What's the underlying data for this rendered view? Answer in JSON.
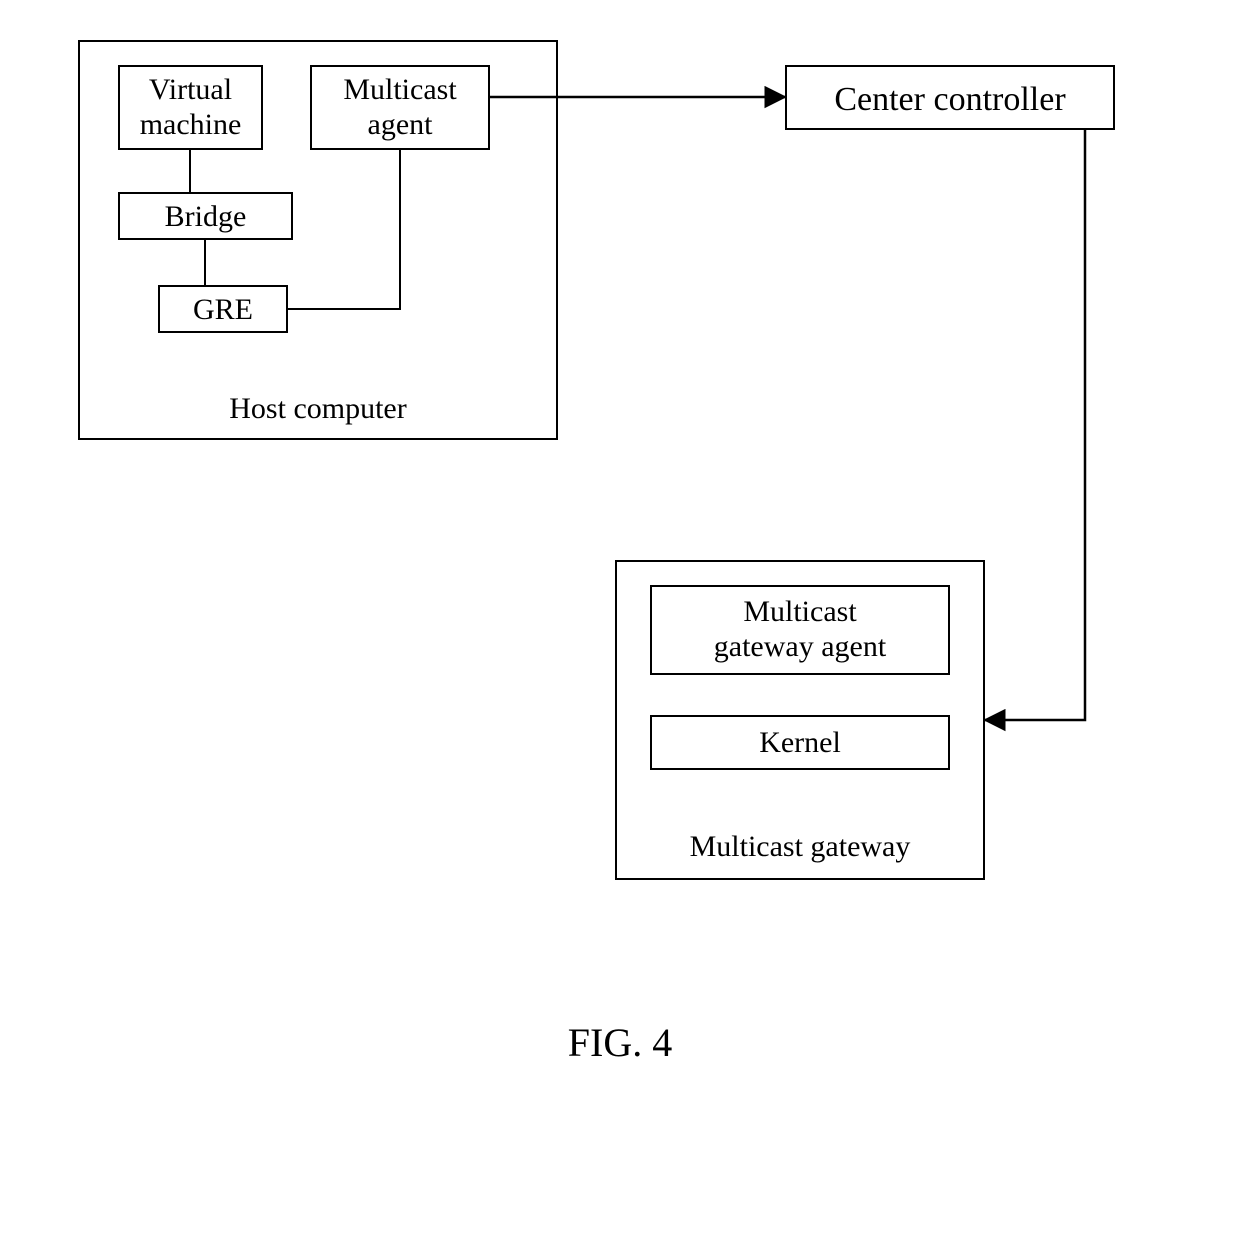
{
  "host_computer": {
    "label": "Host computer",
    "virtual_machine": "Virtual\nmachine",
    "multicast_agent": "Multicast\nagent",
    "bridge": "Bridge",
    "gre": "GRE"
  },
  "center_controller": "Center controller",
  "multicast_gateway": {
    "label": "Multicast gateway",
    "multicast_gateway_agent": "Multicast\ngateway agent",
    "kernel": "Kernel"
  },
  "figure_caption": "FIG. 4"
}
